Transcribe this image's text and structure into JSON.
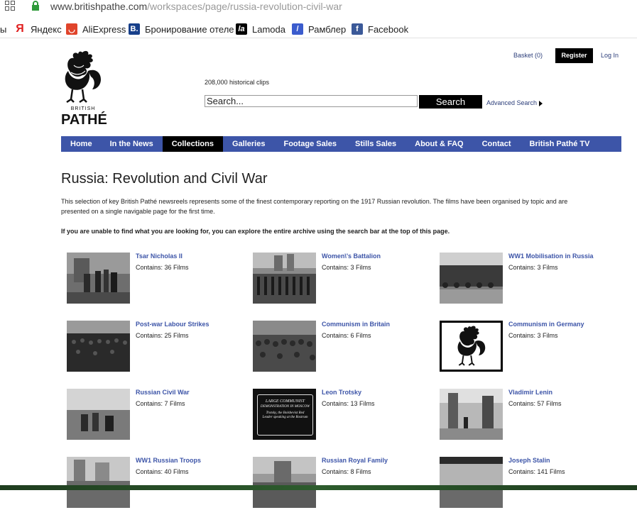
{
  "browser": {
    "url_host": "www.britishpathe.com",
    "url_path": "/workspaces/page/russia-revolution-civil-war",
    "bookmarks": [
      {
        "label": "ы",
        "icon": "none"
      },
      {
        "label": "Яндекс",
        "icon": "yandex-icon",
        "color": "#e02020"
      },
      {
        "label": "AliExpress",
        "icon": "aliexpress-icon",
        "color": "#e0442b"
      },
      {
        "label": "Бронирование отеле",
        "icon": "booking-icon",
        "color": "#173f8a"
      },
      {
        "label": "Lamoda",
        "icon": "lamoda-icon",
        "color": "#000000"
      },
      {
        "label": "Рамблер",
        "icon": "rambler-icon",
        "color": "#3b5ccd"
      },
      {
        "label": "Facebook",
        "icon": "facebook-icon",
        "color": "#3b5998"
      }
    ]
  },
  "header": {
    "logo_line1": "BRITISH",
    "logo_line2": "PATHÉ",
    "clips_count": "208,000 historical clips",
    "search_value": "Search...",
    "search_button": "Search",
    "advanced_search": "Advanced Search",
    "basket": "Basket (0)",
    "register": "Register",
    "login": "Log In"
  },
  "nav": [
    {
      "label": "Home",
      "active": false
    },
    {
      "label": "In the News",
      "active": false
    },
    {
      "label": "Collections",
      "active": true
    },
    {
      "label": "Galleries",
      "active": false
    },
    {
      "label": "Footage Sales",
      "active": false
    },
    {
      "label": "Stills Sales",
      "active": false
    },
    {
      "label": "About & FAQ",
      "active": false
    },
    {
      "label": "Contact",
      "active": false
    },
    {
      "label": "British Pathé TV",
      "active": false
    }
  ],
  "page": {
    "title": "Russia: Revolution and Civil War",
    "intro": "This selection of key British Pathé newsreels represents some of the finest contemporary reporting on the 1917 Russian revolution. The films have been organised by topic and are presented on a single navigable page for the first time.",
    "note": "If you are unable to find what you are looking for, you can explore the entire archive using the search bar at the top of this page."
  },
  "collections": [
    {
      "title": "Tsar Nicholas II",
      "count": "Contains: 36 Films",
      "thumb": "photo"
    },
    {
      "title": "Women\\'s Battalion",
      "count": "Contains: 3 Films",
      "thumb": "photo"
    },
    {
      "title": "WW1 Mobilisation in Russia",
      "count": "Contains: 3 Films",
      "thumb": "photo"
    },
    {
      "title": "Post-war Labour Strikes",
      "count": "Contains: 25 Films",
      "thumb": "photo"
    },
    {
      "title": "Communism in Britain",
      "count": "Contains: 6 Films",
      "thumb": "photo"
    },
    {
      "title": "Communism in Germany",
      "count": "Contains: 3 Films",
      "thumb": "logo"
    },
    {
      "title": "Russian Civil War",
      "count": "Contains: 7 Films",
      "thumb": "photo"
    },
    {
      "title": "Leon Trotsky",
      "count": "Contains: 13 Films",
      "thumb": "card"
    },
    {
      "title": "Vladimir Lenin",
      "count": "Contains: 57 Films",
      "thumb": "photo"
    },
    {
      "title": "WW1 Russian Troops",
      "count": "Contains: 40 Films",
      "thumb": "photo"
    },
    {
      "title": "Russian Royal Family",
      "count": "Contains: 8 Films",
      "thumb": "photo"
    },
    {
      "title": "Joseph Stalin",
      "count": "Contains: 141 Films",
      "thumb": "photo"
    }
  ],
  "card_text": {
    "line1": "LARGE COMMUNIST",
    "line2": "DEMONSTRATION IN MOSCOW",
    "line3": "Trotsky, the Bolshevist Red Leader speaking at the Rostrum"
  },
  "colors": {
    "nav_bg": "#3d55a8",
    "link": "#3d55a8",
    "black": "#000000"
  }
}
